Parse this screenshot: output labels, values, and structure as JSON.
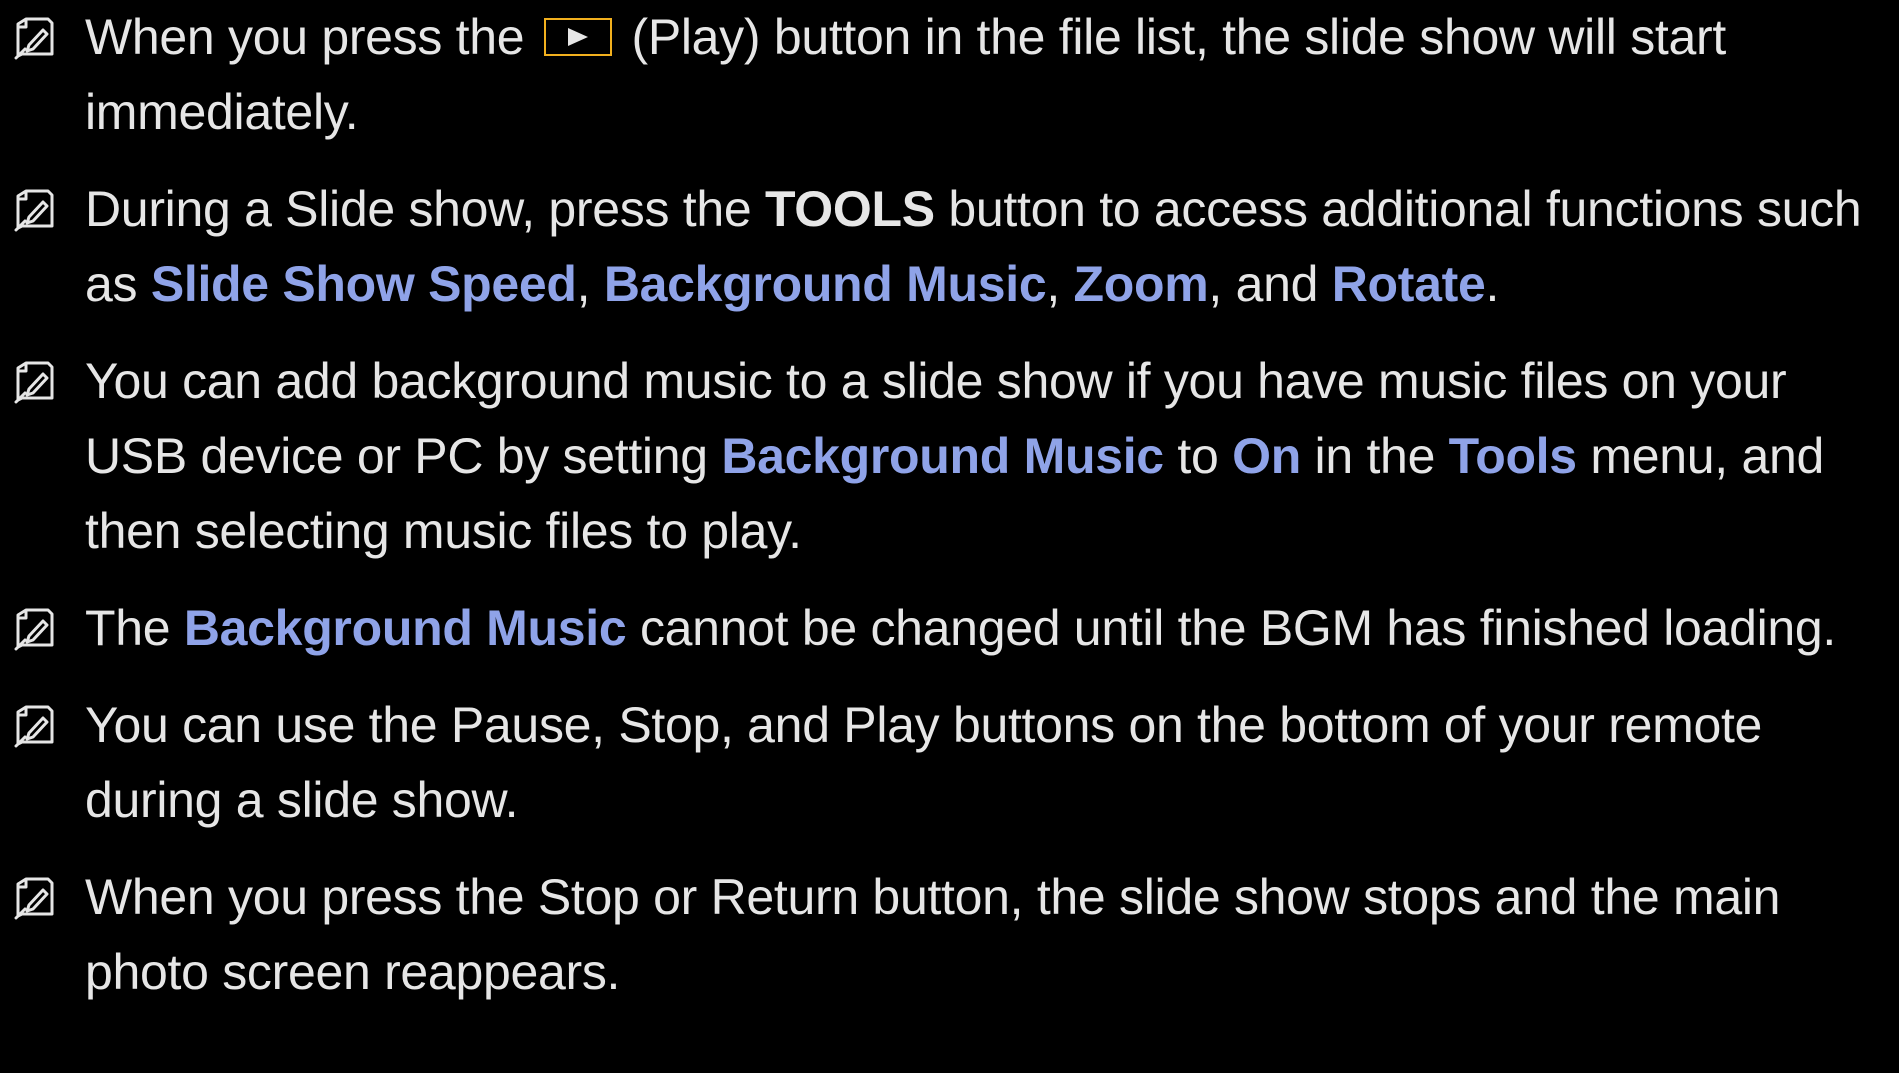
{
  "colors": {
    "background": "#000000",
    "text": "#e6e6e6",
    "highlight": "#8fa3e8",
    "play_button_border": "#f2b01e"
  },
  "icons": {
    "note": "note-icon",
    "play": "play-icon"
  },
  "notes": [
    {
      "parts": [
        "When you press the",
        "(Play) button in the file list, the slide show will start immediately."
      ]
    },
    {
      "parts": [
        "During a Slide show, press the ",
        "TOOLS",
        " button to access additional functions such as ",
        "Slide Show Speed",
        ", ",
        "Background Music",
        ", ",
        "Zoom",
        ", and ",
        "Rotate",
        "."
      ]
    },
    {
      "parts": [
        "You can add background music to a slide show if you have music files on your USB device or PC by setting ",
        "Background Music",
        " to ",
        "On",
        " in the ",
        "Tools",
        " menu, and then selecting music files to play."
      ]
    },
    {
      "parts": [
        "The ",
        "Background Music",
        " cannot be changed until the BGM has finished loading."
      ]
    },
    {
      "parts": [
        "You can use the Pause, Stop, and Play buttons on the bottom of your remote during a slide show."
      ]
    },
    {
      "parts": [
        "When you press the Stop or Return button, the slide show stops and the main photo screen reappears."
      ]
    }
  ]
}
